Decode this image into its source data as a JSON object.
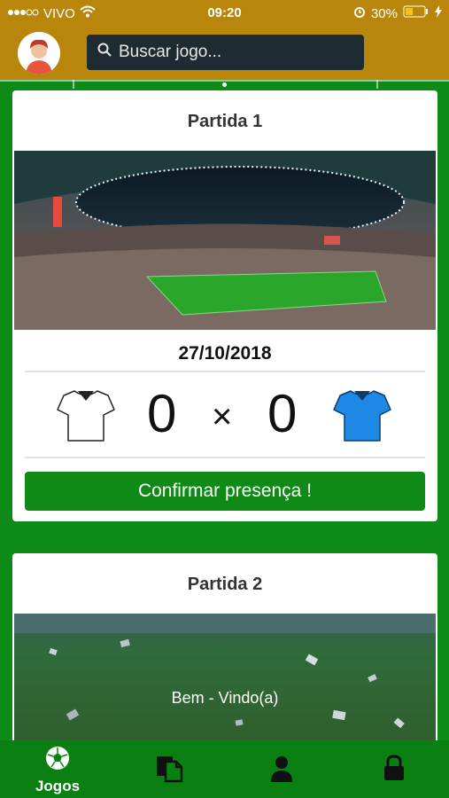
{
  "status_bar": {
    "carrier": "VIVO",
    "time": "09:20",
    "battery": "30%"
  },
  "header": {
    "search": {
      "placeholder": "Buscar jogo..."
    }
  },
  "matches": [
    {
      "title": "Partida 1",
      "date": "27/10/2018",
      "home_score": "0",
      "separator": "×",
      "away_score": "0",
      "confirm_label": "Confirmar presença !"
    },
    {
      "title": "Partida 2",
      "image_caption": "Bem - Vindo(a)"
    }
  ],
  "tabs": [
    {
      "label": "Jogos",
      "icon": "soccer-ball-icon",
      "active": true
    },
    {
      "icon": "documents-icon"
    },
    {
      "icon": "user-icon"
    },
    {
      "icon": "lock-icon"
    }
  ],
  "colors": {
    "status_header": "#b8860b",
    "field_green": "#0d8a17",
    "button_green": "#0f8a16",
    "away_shirt": "#1e88e5"
  }
}
